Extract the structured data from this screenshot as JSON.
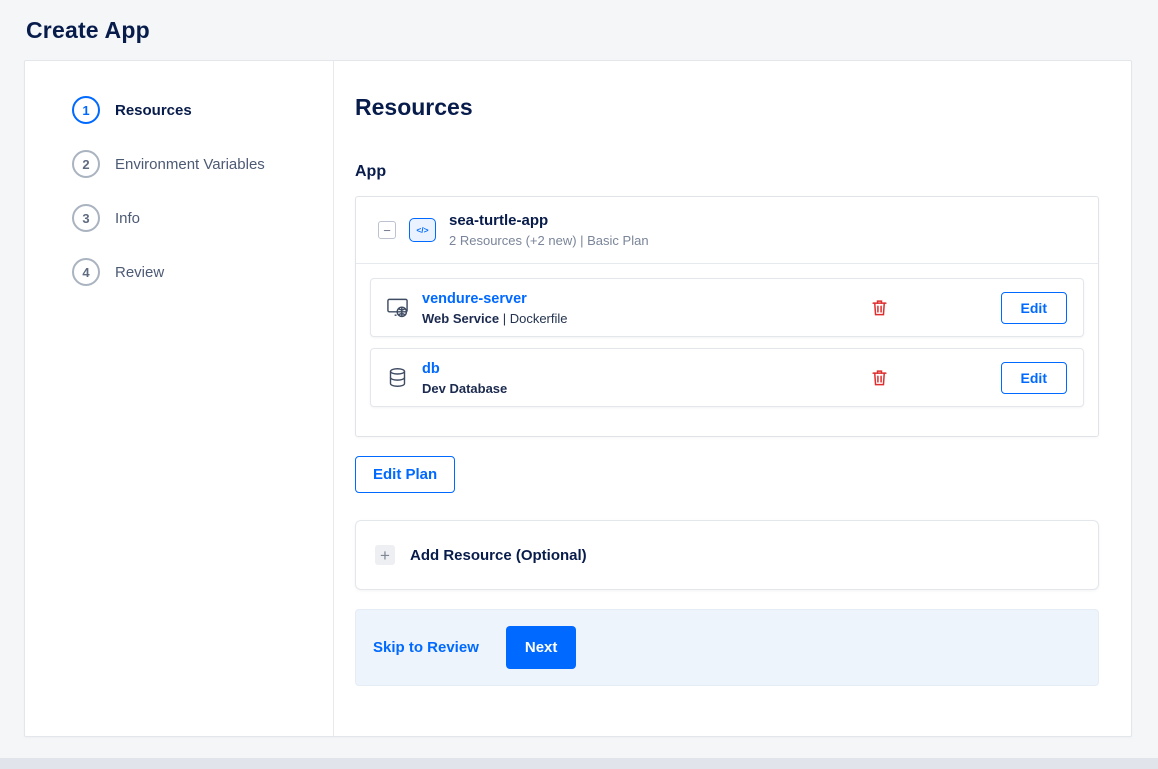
{
  "page": {
    "title": "Create App"
  },
  "stepper": {
    "steps": [
      {
        "number": "1",
        "label": "Resources"
      },
      {
        "number": "2",
        "label": "Environment Variables"
      },
      {
        "number": "3",
        "label": "Info"
      },
      {
        "number": "4",
        "label": "Review"
      }
    ]
  },
  "content": {
    "heading": "Resources",
    "section_label": "App",
    "app_group": {
      "collapse_glyph": "−",
      "icon_glyph": "</>",
      "name": "sea-turtle-app",
      "subtitle": "2 Resources (+2 new) | Basic Plan",
      "resources": [
        {
          "name": "vendure-server",
          "type": "Web Service",
          "detail": " | Dockerfile"
        },
        {
          "name": "db",
          "type": "Dev Database",
          "detail": ""
        }
      ]
    },
    "labels": {
      "edit": "Edit",
      "edit_plan": "Edit Plan",
      "add_glyph": "+",
      "add_resource": "Add Resource (Optional)",
      "skip_to_review": "Skip to Review",
      "next": "Next"
    }
  },
  "colors": {
    "accent": "#0069ff",
    "danger": "#de2e2e",
    "heading": "#081c4b"
  }
}
